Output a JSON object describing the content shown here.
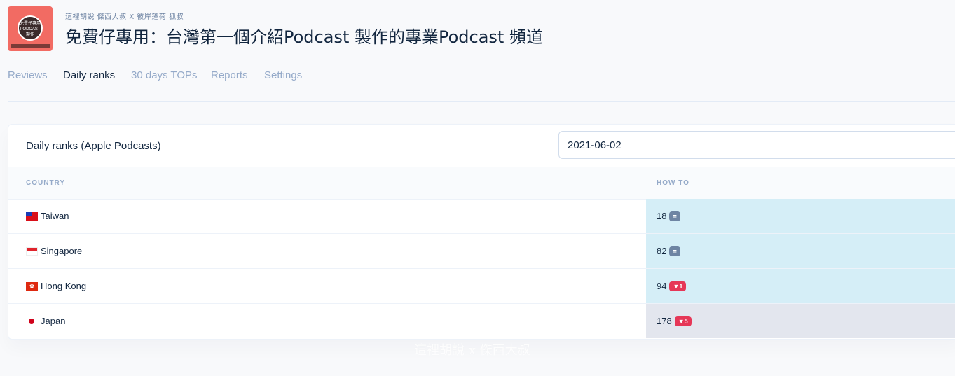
{
  "header": {
    "logo_text": "免費仔專用 PODCAST 製作",
    "pretitle": "這裡胡說 傑西大叔 X 彼岸蓬荷 狐叔",
    "title": "免費仔專用：台灣第一個介紹Podcast 製作的專業Podcast 頻道"
  },
  "tabs": [
    {
      "label": "Reviews"
    },
    {
      "label": "Daily ranks"
    },
    {
      "label": "30 days TOPs"
    },
    {
      "label": "Reports"
    },
    {
      "label": "Settings"
    }
  ],
  "card": {
    "title": "Daily ranks (Apple Podcasts)",
    "date_value": "2021-06-02"
  },
  "table": {
    "columns": [
      "COUNTRY",
      "HOW TO"
    ],
    "rows": [
      {
        "country": "Taiwan",
        "flag_icon": "taiwan-flag-icon",
        "rank": "18",
        "change": "=",
        "change_color": "#6e84a3",
        "cell_bg": "#d5eef7"
      },
      {
        "country": "Singapore",
        "flag_icon": "singapore-flag-icon",
        "rank": "82",
        "change": "=",
        "change_color": "#6e84a3",
        "cell_bg": "#d5eef7"
      },
      {
        "country": "Hong Kong",
        "flag_icon": "hong-kong-flag-icon",
        "rank": "94",
        "change": "▼1",
        "change_color": "#e63757",
        "cell_bg": "#d5eef7"
      },
      {
        "country": "Japan",
        "flag_icon": "japan-flag-icon",
        "rank": "178",
        "change": "▼5",
        "change_color": "#e63757",
        "cell_bg": "#e3e6ee"
      }
    ]
  },
  "watermark": "這裡胡說 x 傑西大叔",
  "colors": {
    "accent": "#2c7be5",
    "text": "#12263f",
    "muted": "#95aac9"
  }
}
